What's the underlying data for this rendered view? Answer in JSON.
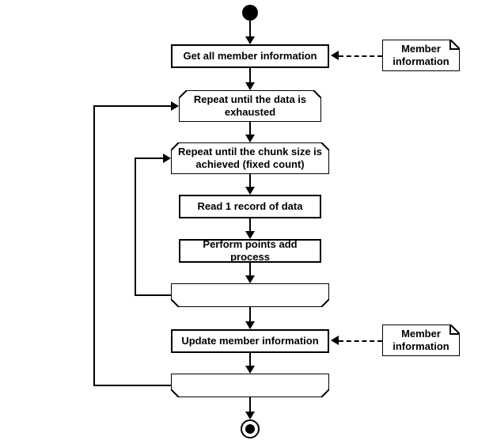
{
  "diagram": {
    "start": "start",
    "end": "end",
    "getAll": "Get all member information",
    "outerLoop": "Repeat until the data is\nexhausted",
    "innerLoop": "Repeat until the chunk size is\nachieved (fixed count)",
    "read1": "Read 1 record of data",
    "addPoints": "Perform points add process",
    "update": "Update member information",
    "note": "Member\ninformation"
  }
}
